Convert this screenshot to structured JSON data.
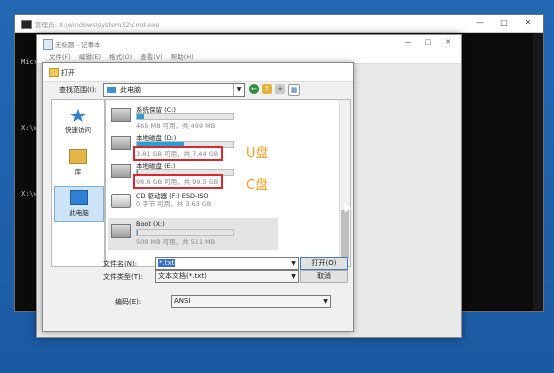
{
  "cmd": {
    "title": "管理员: X:\\windows\\system32\\cmd.exe",
    "lines": [
      "Micro",
      "",
      "X:\\wi",
      "",
      "X:\\wi"
    ],
    "btn_min": "—",
    "btn_max": "□",
    "btn_close": "✕"
  },
  "notepad": {
    "title": "无标题 - 记事本",
    "menu": [
      "文件(F)",
      "编辑(E)",
      "格式(O)",
      "查看(V)",
      "帮助(H)"
    ],
    "btn_min": "—",
    "btn_max": "□",
    "btn_close": "✕"
  },
  "dialog": {
    "title": "打开",
    "lookin_label": "查找范围(I):",
    "lookin_value": "此电脑",
    "places": [
      {
        "label": "快速访问",
        "icon": "star-icon"
      },
      {
        "label": "库",
        "icon": "library-icon"
      },
      {
        "label": "此电脑",
        "icon": "computer-icon"
      }
    ],
    "drives": [
      {
        "name": "系统保留 (C:)",
        "size": "465 MB 可用，共 499 MB",
        "used": 0.07
      },
      {
        "name": "本地磁盘 (D:)",
        "size": "3.81 GB 可用，共 7.44 GB",
        "used": 0.49
      },
      {
        "name": "本地磁盘 (E:)",
        "size": "98.6 GB 可用，共 99.5 GB",
        "used": 0.01
      },
      {
        "name": "CD 驱动器 (F:) ESD-ISO",
        "size": "0 字节 可用，共 3.63 GB",
        "used": 1.0
      },
      {
        "name": "Boot (X:)",
        "size": "508 MB 可用，共 511 MB",
        "used": 0.01
      }
    ],
    "annot_u": "U盘",
    "annot_c": "C盘",
    "filename_label": "文件名(N):",
    "filename_value": "*.txt",
    "filetype_label": "文件类型(T):",
    "filetype_value": "文本文档(*.txt)",
    "encoding_label": "编码(E):",
    "encoding_value": "ANSI",
    "open_button": "打开(O)",
    "cancel_button": "取消"
  },
  "colors": {
    "highlight": "#e0262b",
    "annotation": "#f0a020",
    "usage_bar": "#27a0d8"
  }
}
